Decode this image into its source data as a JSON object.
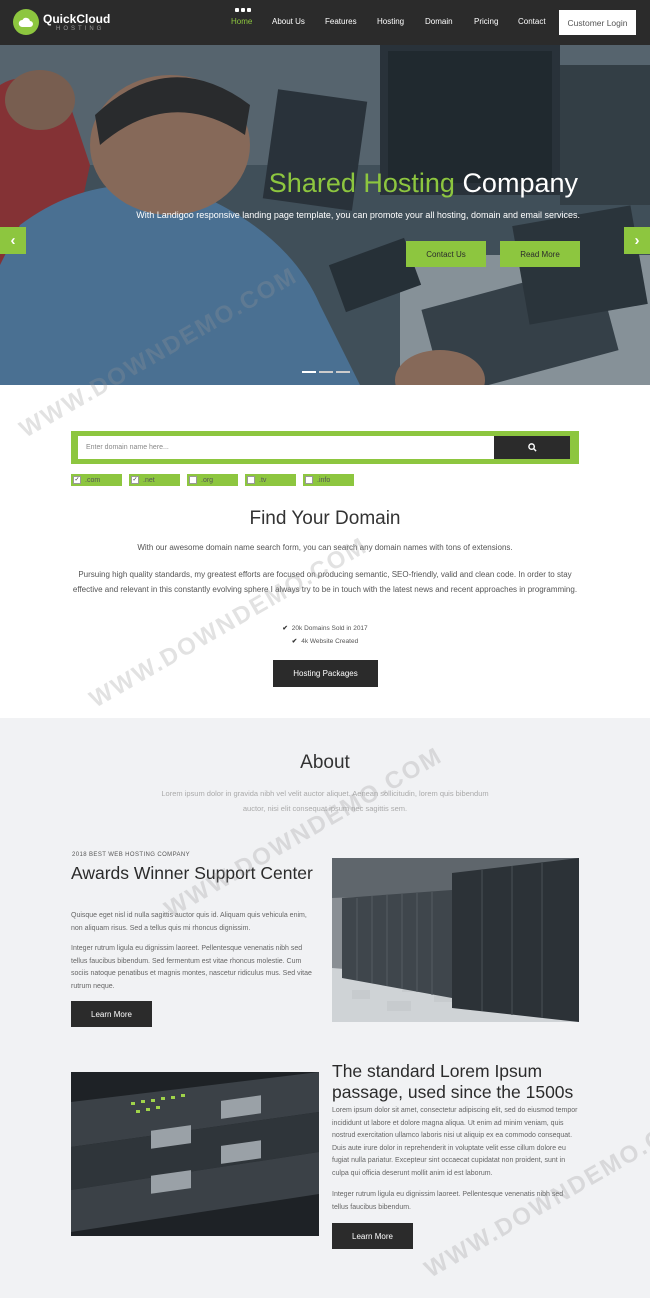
{
  "brand": {
    "name": "QuickCloud",
    "tagline": "HOSTING",
    "accent": "#8dc63f",
    "dark": "#2b2b2b"
  },
  "nav": {
    "items": [
      "Home",
      "About Us",
      "Features",
      "Hosting",
      "Domain",
      "Pricing",
      "Contact"
    ],
    "active": "Home",
    "login": "Customer Login"
  },
  "hero": {
    "title_highlight": "Shared Hosting",
    "title_rest": "Company",
    "subtitle": "With Landigoo responsive landing page template, you can promote your all hosting, domain and email services.",
    "btn_contact": "Contact Us",
    "btn_read": "Read More",
    "prev_icon": "chevron-left-icon",
    "next_icon": "chevron-right-icon"
  },
  "domain": {
    "placeholder": "Enter domain name here...",
    "search_icon": "search-icon",
    "extensions": [
      ".com",
      ".net",
      ".org",
      ".tv",
      ".info"
    ],
    "extensions_checked": [
      ".com",
      ".net"
    ],
    "title": "Find Your Domain",
    "lead": "With our awesome domain name search form, you can search any domain names with tons of extensions.",
    "body": "Pursuing high quality standards, my greatest efforts are focused on producing semantic, SEO-friendly, valid and clean code. In order to stay effective and relevant in this constantly evolving sphere I always try to be in touch with the latest news and recent approaches in programming.",
    "stats": [
      "20k Domains Sold in 2017",
      "4k Website Created"
    ],
    "cta": "Hosting Packages"
  },
  "about": {
    "title": "About",
    "lead": "Lorem ipsum dolor in gravida nibh vel velit auctor aliquet. Aenean sollicitudin, lorem quis bibendum auctor, nisi elit consequat ipsum nec sagittis sem.",
    "block1": {
      "eyebrow": "2018 BEST WEB HOSTING COMPANY",
      "title": "Awards Winner Support Center",
      "p1": "Quisque eget nisl id nulla sagittis auctor quis id. Aliquam quis vehicula enim, non aliquam risus. Sed a tellus quis mi rhoncus dignissim.",
      "p2": "Integer rutrum ligula eu dignissim laoreet. Pellentesque venenatis nibh sed tellus faucibus bibendum. Sed fermentum est vitae rhoncus molestie. Cum sociis natoque penatibus et magnis montes, nascetur ridiculus mus. Sed vitae rutrum neque.",
      "btn": "Learn More"
    },
    "block2": {
      "title": "The standard Lorem Ipsum passage, used since the 1500s",
      "p1": "Lorem ipsum dolor sit amet, consectetur adipiscing elit, sed do eiusmod tempor incididunt ut labore et dolore magna aliqua. Ut enim ad minim veniam, quis nostrud exercitation ullamco laboris nisi ut aliquip ex ea commodo consequat. Duis aute irure dolor in reprehenderit in voluptate velit esse cillum dolore eu fugiat nulla pariatur. Excepteur sint occaecat cupidatat non proident, sunt in culpa qui officia deserunt mollit anim id est laborum.",
      "p2": "Integer rutrum ligula eu dignissim laoreet. Pellentesque venenatis nibh sed tellus faucibus bibendum.",
      "btn": "Learn More"
    }
  },
  "watermark": "WWW.DOWNDEMO.COM"
}
